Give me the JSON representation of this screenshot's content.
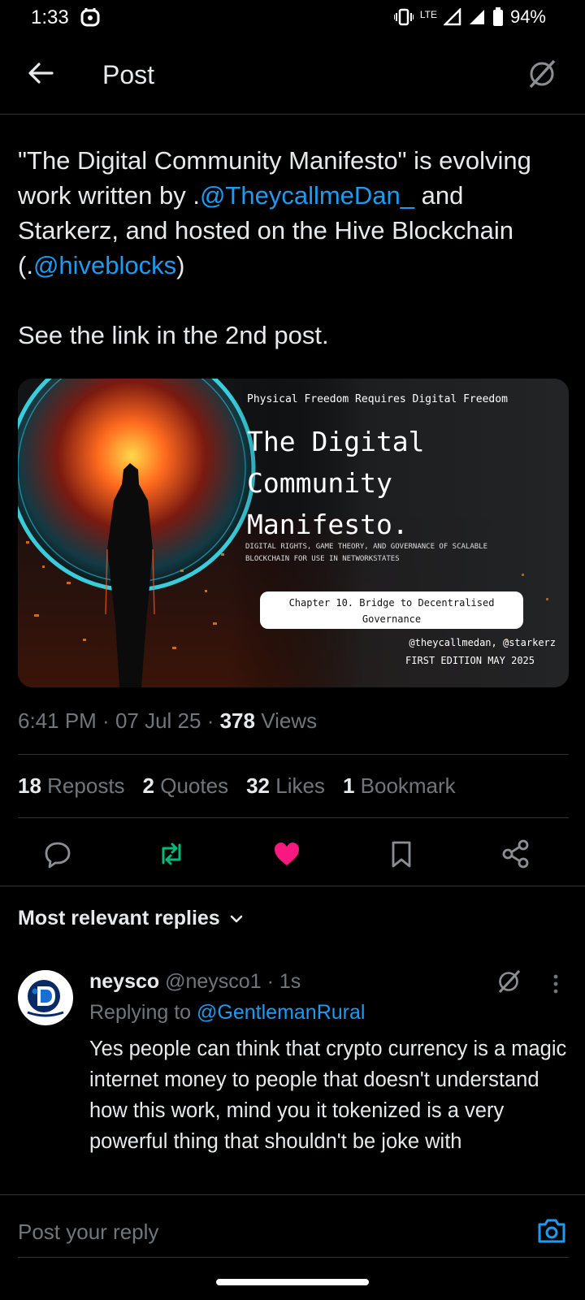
{
  "status_bar": {
    "time": "1:33",
    "network": "LTE",
    "battery": "94%"
  },
  "header": {
    "title": "Post"
  },
  "post": {
    "text_1": "\"The Digital Community Manifesto\" is evolving work written by .",
    "mention_1": "@TheycallmeDan_",
    "text_2": " and Starkerz, and hosted on the Hive Blockchain (.",
    "mention_2": "@hiveblocks",
    "text_3": ")\n\nSee the link in the 2nd post.",
    "image": {
      "tagline": "Physical Freedom Requires Digital Freedom",
      "title_line_1": "The Digital",
      "title_line_2": "Community",
      "title_line_3": "Manifesto.",
      "subtitle_line_1": "DIGITAL RIGHTS, GAME THEORY, AND GOVERNANCE OF SCALABLE",
      "subtitle_line_2": "BLOCKCHAIN FOR USE IN NETWORKSTATES",
      "chapter_line_1": "Chapter 10. Bridge to Decentralised",
      "chapter_line_2": "Governance",
      "authors": "@theycallmedan, @starkerz",
      "edition": "FIRST EDITION MAY 2025"
    },
    "time": "6:41 PM",
    "date": "07 Jul 25",
    "views_count": "378",
    "views_label": "Views",
    "stats": {
      "reposts_count": "18",
      "reposts_label": "Reposts",
      "quotes_count": "2",
      "quotes_label": "Quotes",
      "likes_count": "32",
      "likes_label": "Likes",
      "bookmarks_count": "1",
      "bookmarks_label": "Bookmark"
    }
  },
  "colors": {
    "accent": "#1d9bf0",
    "repost_active": "#00ba7c",
    "like_active": "#f91880",
    "muted": "#71767b"
  },
  "replies": {
    "sort_label": "Most relevant replies",
    "items": [
      {
        "name": "neysco",
        "handle": "@neysco1",
        "time": "1s",
        "replying_prefix": "Replying to ",
        "replying_to": "@GentlemanRural",
        "text": "Yes people can think that crypto currency is a magic internet money to people that doesn't understand how this work, mind you it tokenized is a very powerful thing that shouldn't be joke with"
      }
    ]
  },
  "composer": {
    "placeholder": "Post your reply"
  }
}
